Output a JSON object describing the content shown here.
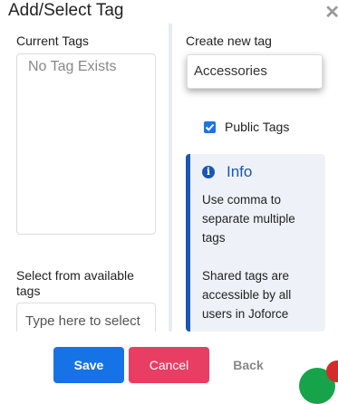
{
  "dialog": {
    "title": "Add/Select Tag",
    "close_icon": "close-icon"
  },
  "left": {
    "current_label": "Current Tags",
    "current_empty": "No Tag Exists",
    "available_label": "Select from available tags",
    "available_placeholder": "Type here to select"
  },
  "right": {
    "create_label": "Create new tag",
    "new_tag_value": "Accessories",
    "public_label": "Public Tags",
    "public_checked": true
  },
  "info": {
    "icon": "info-circle-icon",
    "title": "Info",
    "line1": "Use comma to separate multiple tags",
    "line2": "Shared tags are accessible by all users in Joforce"
  },
  "footer": {
    "save": "Save",
    "cancel": "Cancel",
    "back": "Back"
  },
  "colors": {
    "primary": "#1673e6",
    "danger": "#e83e63",
    "info_accent": "#1a56b4"
  }
}
